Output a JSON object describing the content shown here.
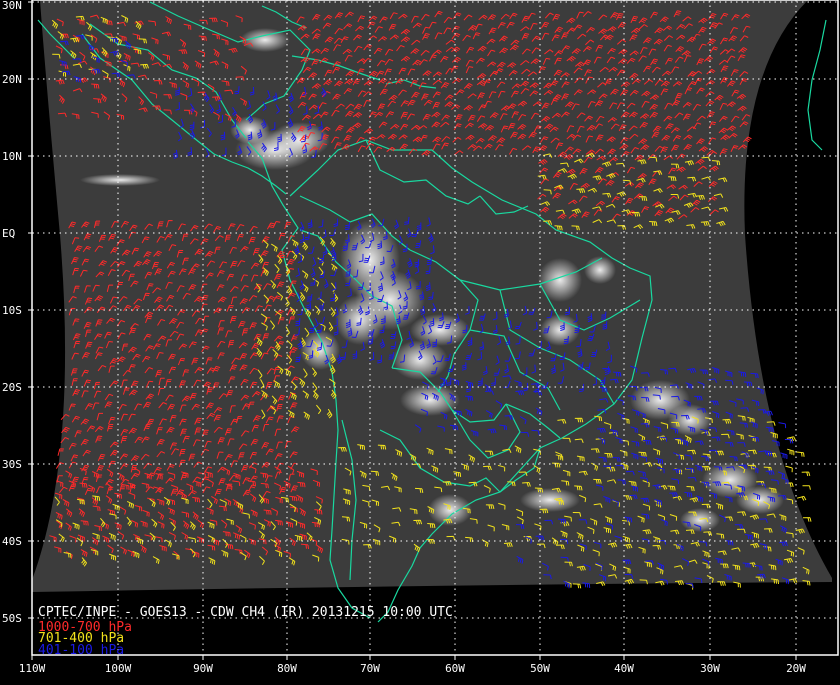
{
  "map": {
    "caption": "CPTEC/INPE - GOES13 - CDW CH4 (IR) 20131215 10:00 UTC",
    "legend": [
      {
        "label": "1000-700 hPa",
        "color": "#ff2a2a"
      },
      {
        "label": "701-400 hPa",
        "color": "#f2e21c"
      },
      {
        "label": "401-100 hPa",
        "color": "#1a1ae6"
      }
    ],
    "lat_labels": [
      "30N",
      "20N",
      "10N",
      "EQ",
      "10S",
      "20S",
      "30S",
      "40S",
      "50S"
    ],
    "lon_labels": [
      "110W",
      "100W",
      "90W",
      "80W",
      "70W",
      "60W",
      "50W",
      "40W",
      "30W",
      "20W"
    ],
    "coast_color": "#19d9a0",
    "grid_color": "#ffffff",
    "frame_color": "#ffffff"
  }
}
